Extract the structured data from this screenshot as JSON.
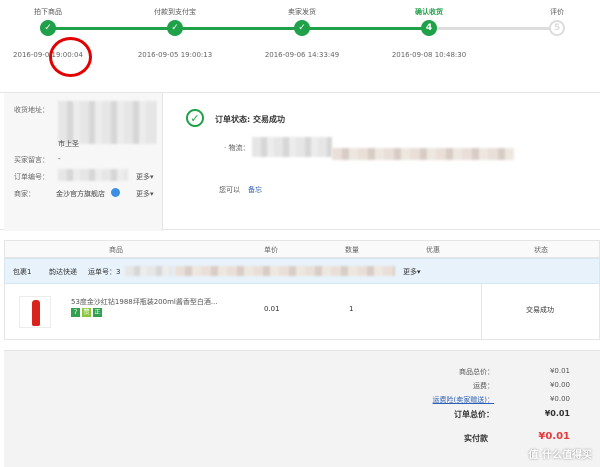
{
  "progress": {
    "steps": [
      {
        "label": "拍下商品",
        "time": "2016-09-0",
        "time_tail": "19:00:04",
        "marker": "check"
      },
      {
        "label": "付款到支付宝",
        "time": "2016-09-05 19:00:13",
        "marker": "check"
      },
      {
        "label": "卖家发货",
        "time": "2016-09-06 14:33:49",
        "marker": "check"
      },
      {
        "label": "确认收货",
        "time": "2016-09-08 10:48:30",
        "marker": "4"
      },
      {
        "label": "评价",
        "marker": "5"
      }
    ],
    "colors": {
      "done": "#1fa14a",
      "pending": "#dddddd",
      "current_label": "#1fa14a"
    }
  },
  "order_info": {
    "address_label": "收货地址：",
    "address_tail": "市上圣",
    "message_label": "买家留言：",
    "message_value": "-",
    "order_no_label": "订单编号：",
    "order_no_more": "更多▾",
    "seller_label": "商家：",
    "seller_value": "金沙官方旗舰店",
    "seller_more": "更多▾"
  },
  "status": {
    "title": "订单状态: 交易成功",
    "logistics_label": "· 物流：",
    "you_can": "您可以",
    "memo_link": "备忘"
  },
  "table": {
    "headers": [
      "商品",
      "单价",
      "数量",
      "优惠",
      "状态"
    ],
    "package": {
      "label": "包裹1",
      "courier": "韵达快递",
      "tracking_label": "运单号：3",
      "more": "更多▾"
    },
    "item": {
      "name": "53度金沙红钻1988坪瓶装200ml酱香型白酒...",
      "price": "0.01",
      "qty": "1",
      "status": "交易成功",
      "badges": [
        "7",
        "赞",
        "正"
      ]
    }
  },
  "totals": {
    "rows": [
      {
        "label": "商品总价：",
        "value": "¥0.01"
      },
      {
        "label": "运费：",
        "value": "¥0.00"
      },
      {
        "label": "运费险(卖家赠送)：",
        "value": "¥0.00"
      }
    ],
    "order_total_label": "订单总价：",
    "order_total_value": "¥0.01",
    "paid_label": "实付款",
    "paid_value": "¥0.01"
  },
  "watermark": {
    "text": "值 什么值得买"
  }
}
